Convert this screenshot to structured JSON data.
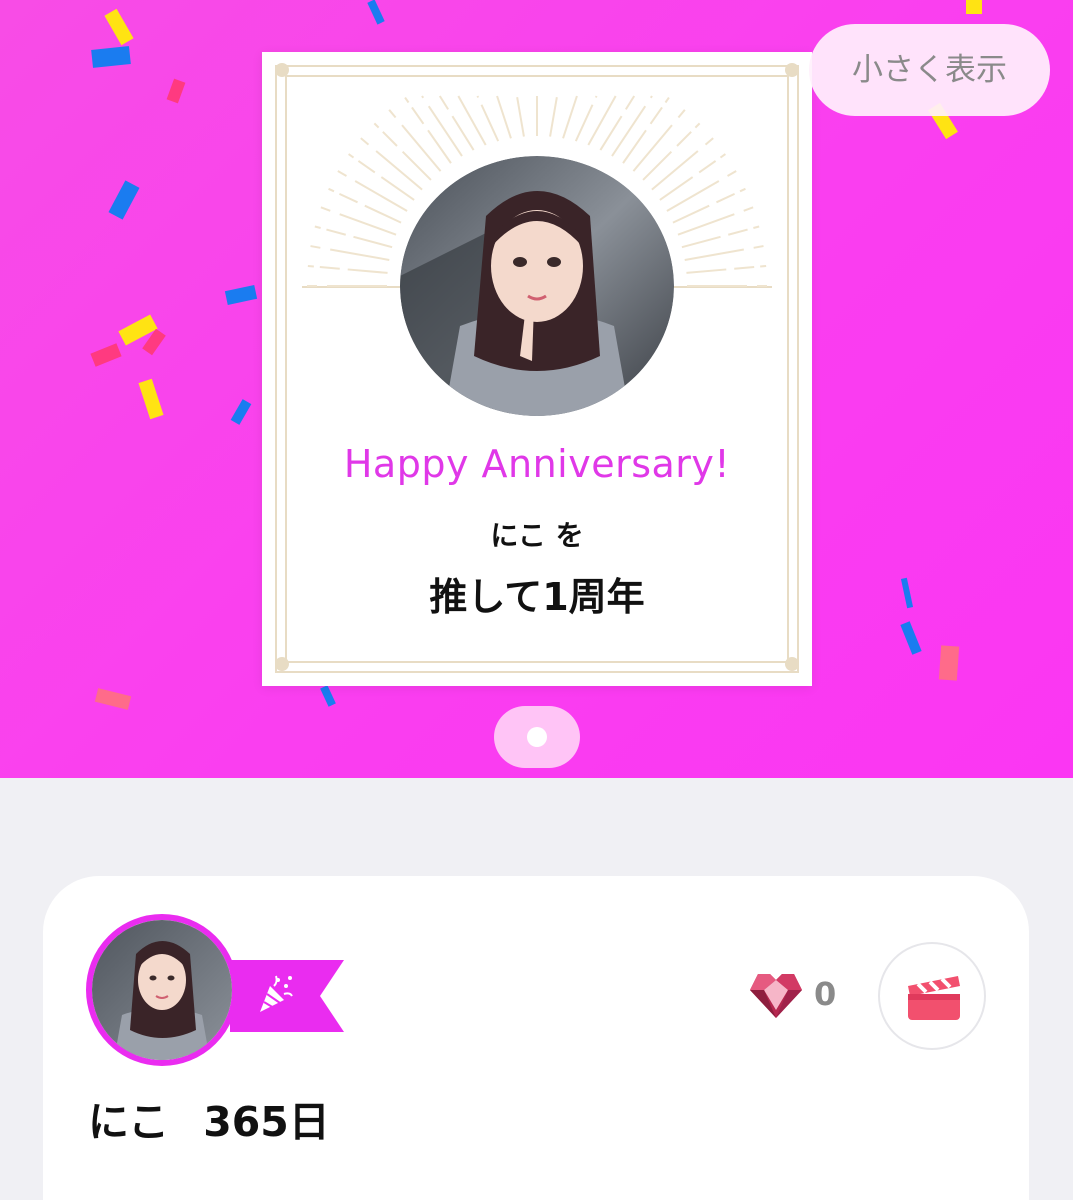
{
  "header": {
    "small_view_button": "小さく表示"
  },
  "anniversary_card": {
    "greeting": "Happy Anniversary!",
    "name_line": "にこ を",
    "duration_line": "推して1周年"
  },
  "pager": {
    "current_page": 1,
    "total_pages": 1
  },
  "profile": {
    "name": "にこ",
    "days": "365日",
    "gem_count": "0"
  },
  "icons": [
    "party-popper-icon",
    "heart-gem-icon",
    "movie-clapperboard-icon"
  ],
  "colors": {
    "hero_background": "#f84ce6",
    "accent": "#ea2cf0",
    "greeting_text": "#e038e8",
    "gem": "#c4305a",
    "clapper": "#f2506e",
    "card_frame": "#e8dcc4"
  }
}
